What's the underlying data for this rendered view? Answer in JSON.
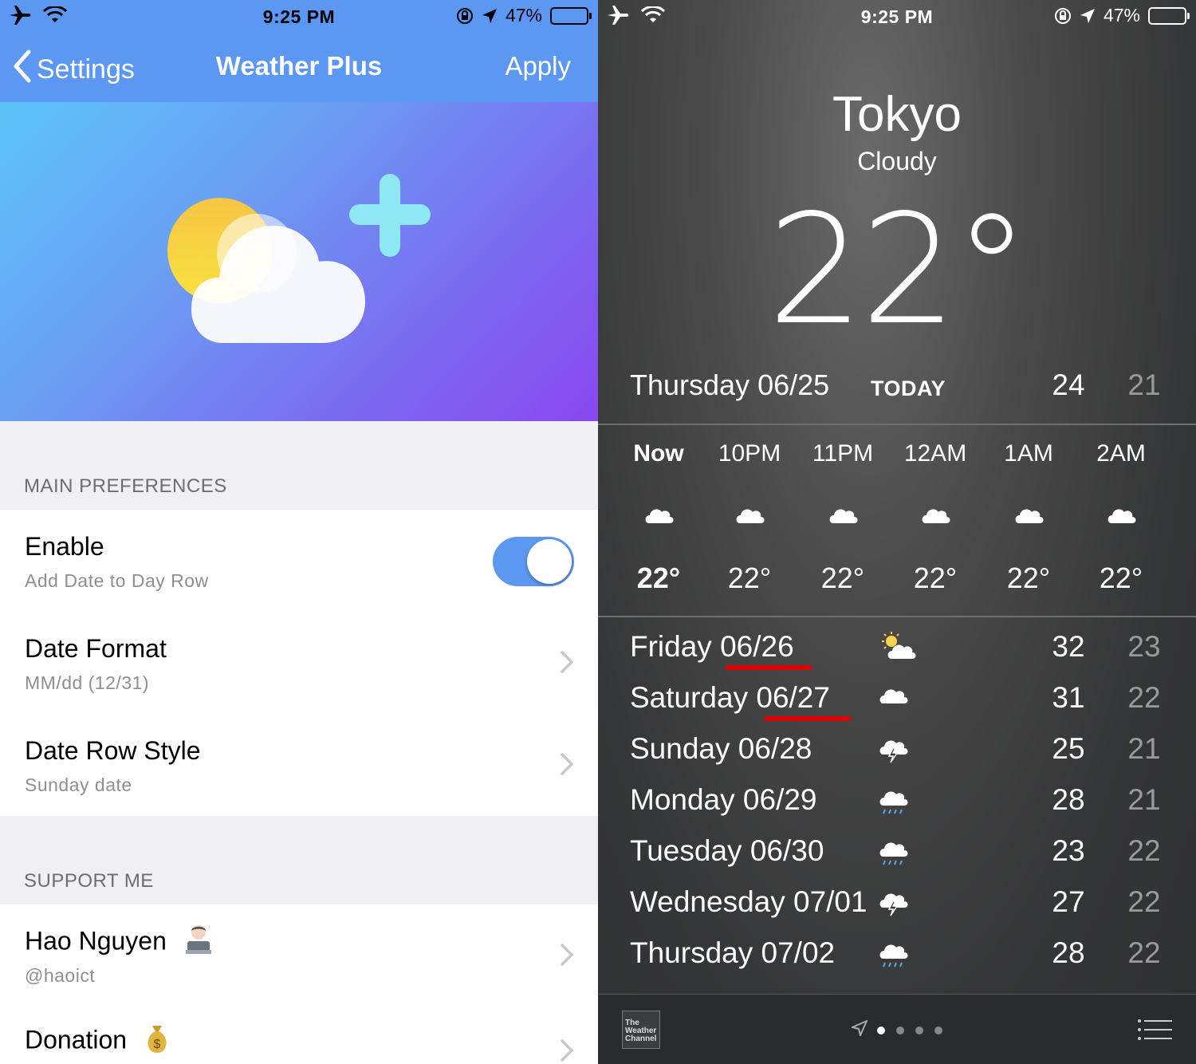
{
  "status_left": {
    "time": "9:25 PM",
    "battery": "47%"
  },
  "status_right": {
    "time": "9:25 PM",
    "battery": "47%"
  },
  "settings": {
    "back_label": "Settings",
    "title": "Weather Plus",
    "apply_label": "Apply",
    "section_main": "MAIN PREFERENCES",
    "enable_title": "Enable",
    "enable_sub": "Add Date to Day Row",
    "enable_on": true,
    "date_format_title": "Date Format",
    "date_format_value": "MM/dd (12/31)",
    "date_row_style_title": "Date Row Style",
    "date_row_style_value": "Sunday date",
    "section_support": "SUPPORT ME",
    "author_name": "Hao Nguyen",
    "author_handle": "@haoict",
    "donation_label": "Donation"
  },
  "weather": {
    "city": "Tokyo",
    "condition": "Cloudy",
    "temperature": "22°",
    "today": {
      "day": "Thursday 06/25",
      "tag": "TODAY",
      "high": "24",
      "low": "21"
    },
    "hourly": [
      {
        "label": "Now",
        "icon": "cloud-icon",
        "temp": "22°"
      },
      {
        "label": "10PM",
        "icon": "cloud-icon",
        "temp": "22°"
      },
      {
        "label": "11PM",
        "icon": "cloud-icon",
        "temp": "22°"
      },
      {
        "label": "12AM",
        "icon": "cloud-icon",
        "temp": "22°"
      },
      {
        "label": "1AM",
        "icon": "cloud-icon",
        "temp": "22°"
      },
      {
        "label": "2AM",
        "icon": "cloud-icon",
        "temp": "22°"
      }
    ],
    "daily": [
      {
        "day": "Friday 06/26",
        "icon": "partly-sunny-icon",
        "high": "32",
        "low": "23"
      },
      {
        "day": "Saturday 06/27",
        "icon": "cloud-icon",
        "high": "31",
        "low": "22"
      },
      {
        "day": "Sunday 06/28",
        "icon": "thunderstorm-icon",
        "high": "25",
        "low": "21"
      },
      {
        "day": "Monday 06/29",
        "icon": "rain-icon",
        "high": "28",
        "low": "21"
      },
      {
        "day": "Tuesday 06/30",
        "icon": "rain-icon",
        "high": "23",
        "low": "22"
      },
      {
        "day": "Wednesday 07/01",
        "icon": "thunderstorm-icon",
        "high": "27",
        "low": "22"
      },
      {
        "day": "Thursday 07/02",
        "icon": "rain-icon",
        "high": "28",
        "low": "22"
      }
    ],
    "provider_logo": "The Weather Channel",
    "page_count": 4,
    "active_page": 1,
    "underline_color": "#e00000"
  }
}
